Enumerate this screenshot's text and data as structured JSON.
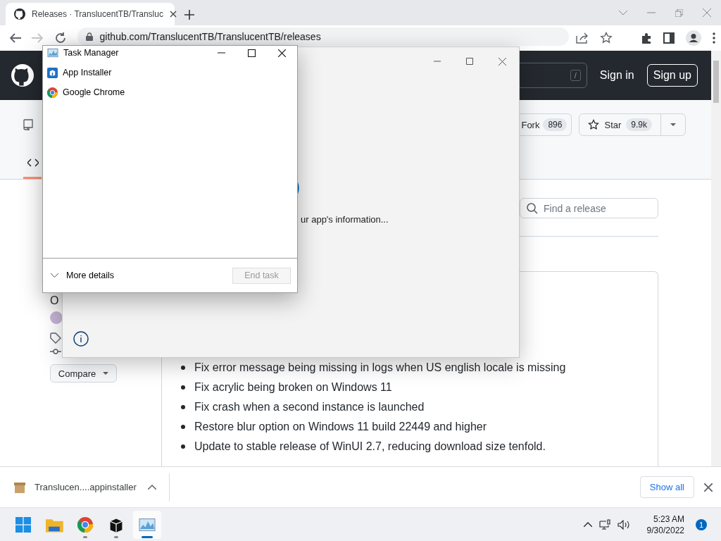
{
  "browser": {
    "tabs": [
      {
        "title": "Releases · TranslucentTB/Transluc",
        "selected": true
      }
    ],
    "address": "github.com/TranslucentTB/TranslucentTB/releases"
  },
  "github": {
    "search_key": "/",
    "sign_in": "Sign in",
    "sign_up": "Sign up",
    "repo_actions": [
      {
        "kind": "fork",
        "label": "Fork",
        "count": "896"
      },
      {
        "kind": "star",
        "label": "Star",
        "count": "9.9k"
      }
    ],
    "release_search": {
      "placeholder": "Find a release"
    },
    "sidebar_text": "O",
    "compare_button": "Compare",
    "release_notes": [
      "Fix error message being missing in logs when US english locale is missing",
      "Fix acrylic being broken on Windows 11",
      "Fix crash when a second instance is launched",
      "Restore blur option on Windows 11 build 22449 and higher",
      "Update to stable release of WinUI 2.7, reducing download size tenfold."
    ]
  },
  "downloads": {
    "file": "Translucen....appinstaller",
    "show_all": "Show all"
  },
  "app_installer": {
    "status": "ur app's information..."
  },
  "task_manager": {
    "title": "Task Manager",
    "apps": [
      {
        "kind": "installer",
        "name": "App Installer"
      },
      {
        "kind": "chrome",
        "name": "Google Chrome"
      }
    ],
    "more_details": "More details",
    "end_task": {
      "label": "End task",
      "disabled": true
    }
  },
  "taskbar": {
    "apps": [
      {
        "kind": "start",
        "running": false,
        "selected": false
      },
      {
        "kind": "explorer",
        "running": false,
        "selected": false
      },
      {
        "kind": "chrome",
        "running": true,
        "selected": false
      },
      {
        "kind": "installer",
        "running": true,
        "selected": false
      },
      {
        "kind": "taskmgr",
        "running": true,
        "selected": true
      }
    ],
    "time": "5:23 AM",
    "date": "9/30/2022",
    "notifications": "1"
  }
}
